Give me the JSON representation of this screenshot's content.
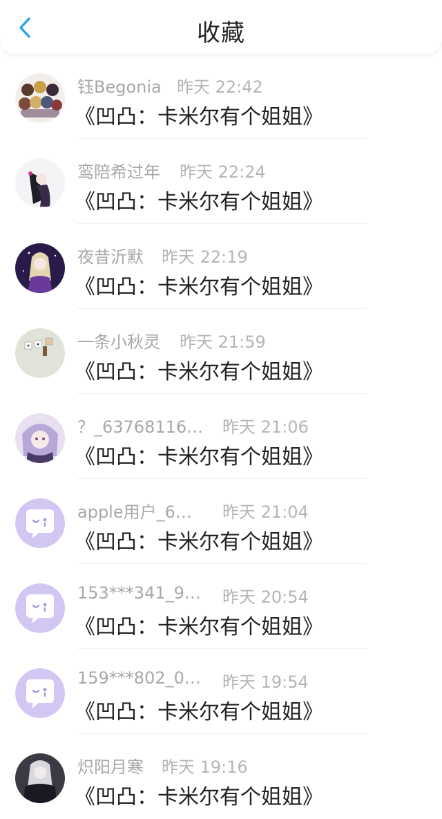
{
  "header": {
    "title": "收藏",
    "back_icon": "chevron-left-icon",
    "accent": "#2aa3ef"
  },
  "items": [
    {
      "name": "钰Begonia",
      "time": "昨天 22:42",
      "work": "《凹凸：卡米尔有个姐姐》",
      "avatar": "group-cartoon-avatar"
    },
    {
      "name": "鸾陪希过年",
      "time": "昨天 22:24",
      "work": "《凹凸：卡米尔有个姐姐》",
      "avatar": "dark-anime-avatar"
    },
    {
      "name": "夜昔沂默",
      "time": "昨天 22:19",
      "work": "《凹凸：卡米尔有个姐姐》",
      "avatar": "purple-anime-avatar"
    },
    {
      "name": "一条小秋灵",
      "time": "昨天 21:59",
      "work": "《凹凸：卡米尔有个姐姐》",
      "avatar": "dice-photo-avatar"
    },
    {
      "name": "？_63768116…",
      "time": "昨天 21:06",
      "work": "《凹凸：卡米尔有个姐姐》",
      "avatar": "anime-girl-avatar"
    },
    {
      "name": "apple用户_6…",
      "time": "昨天 21:04",
      "work": "《凹凸：卡米尔有个姐姐》",
      "avatar": "default-chat-avatar"
    },
    {
      "name": "153***341_9…",
      "time": "昨天 20:54",
      "work": "《凹凸：卡米尔有个姐姐》",
      "avatar": "default-chat-avatar"
    },
    {
      "name": "159***802_0…",
      "time": "昨天 19:54",
      "work": "《凹凸：卡米尔有个姐姐》",
      "avatar": "default-chat-avatar"
    },
    {
      "name": "炽阳月寒",
      "time": "昨天 19:16",
      "work": "《凹凸：卡米尔有个姐姐》",
      "avatar": "dark-character-avatar"
    }
  ]
}
